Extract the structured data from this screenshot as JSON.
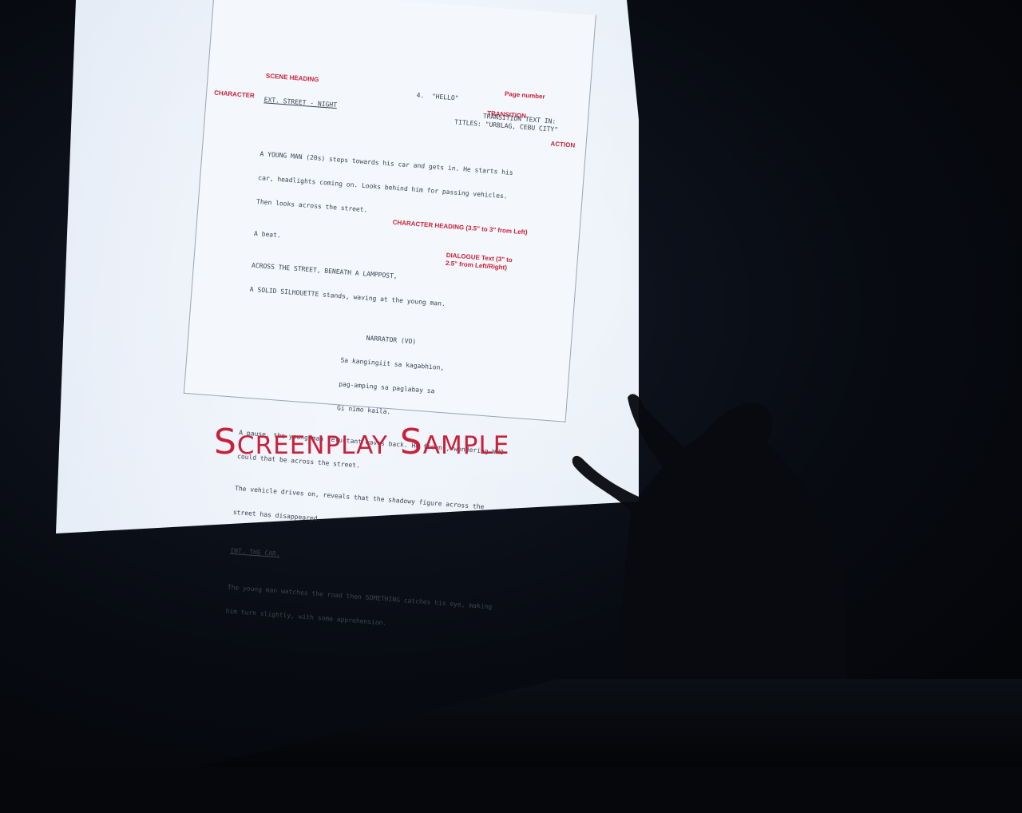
{
  "slide": {
    "title": "Screenplay Sample"
  },
  "labels": {
    "scene_heading": "SCENE HEADING",
    "character": "CHARACTER",
    "page_number": "Page number",
    "transition": "TRANSITION",
    "action": "ACTION",
    "character_heading": "CHARACTER HEADING (3.5\" to 3\" from Left)",
    "dialogue": "DIALOGUE Text (3\" to 2.5\" from Left/Right)"
  },
  "screenplay": {
    "scene_heading_line": "EXT. STREET - NIGHT",
    "page_line": "4.  \"HELLO\"",
    "transition_line_1": "TRANSITION TEXT IN:",
    "transition_line_2": "TITLES: \"URBLAG, CEBU CITY\"",
    "action_1_line_1": "A YOUNG MAN (20s) steps towards his car and gets in. He starts his",
    "action_1_line_2": "car, headlights coming on. Looks behind him for passing vehicles.",
    "action_1_line_3": "Then looks across the street.",
    "action_2": "A beat.",
    "action_3_line_1": "ACROSS THE STREET, BENEATH A LAMPPOST,",
    "action_3_line_2": "A SOLID SILHOUETTE stands, waving at the young man.",
    "character_name": "NARRATOR (VO)",
    "dialogue_line_1": "Sa kangingiit sa kagabhion,",
    "dialogue_line_2": "pag-amping sa paglabay sa",
    "dialogue_line_3": "Gi nimo kaila.",
    "action_4_line_1": "A pause, the young man reluctant waves back. He frowns, wondering WHO",
    "action_4_line_2": "could that be across the street.",
    "action_5_line_1": "The vehicle drives on, reveals that the shadowy figure across the",
    "action_5_line_2": "street has disappeared.",
    "scene_heading_2": "INT. THE CAR.",
    "action_6_line_1": "The young man watches the road then SOMETHING catches his eye, making",
    "action_6_line_2": "him turn slightly, with some apprehension."
  },
  "colors": {
    "accent_red": "#c8223a",
    "screen": "#e6edf7",
    "room": "#05070c"
  }
}
